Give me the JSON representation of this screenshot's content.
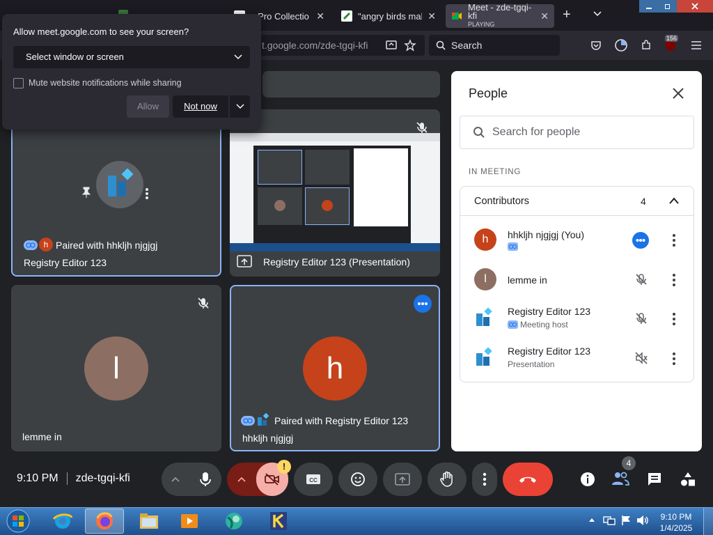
{
  "browser": {
    "tabs": [
      {
        "label": "s Pro Collectio",
        "close": "✕"
      },
      {
        "label": "\"angry birds maker",
        "close": "✕"
      },
      {
        "label": "Meet - zde-tgqi-kfi",
        "sub": "PLAYING",
        "close": "✕"
      }
    ],
    "new_tab": "+",
    "url": "t.google.com/zde-tgqi-kfi",
    "search_placeholder": "Search",
    "badge_count": "156"
  },
  "share_popup": {
    "title": "Allow meet.google.com to see your screen?",
    "select_value": "Select window or screen",
    "checkbox_label": "Mute website notifications while sharing",
    "allow": "Allow",
    "not_now": "Not now"
  },
  "tiles": {
    "t1": {
      "line1": "Paired with hhkljh njgjgj",
      "line2": "Registry Editor 123",
      "chip_letter": "h"
    },
    "t2": {
      "name": "Registry Editor 123 (Presentation)"
    },
    "t3": {
      "name": "lemme in",
      "avatar": "l"
    },
    "t4": {
      "line1": "Paired with Registry Editor 123",
      "line2": "hhkljh njgjgj",
      "avatar": "h"
    }
  },
  "people": {
    "title": "People",
    "search_placeholder": "Search for people",
    "section": "IN MEETING",
    "group": "Contributors",
    "count": "4",
    "rows": [
      {
        "name": "hhkljh njgjgj (You)",
        "avatar": "h",
        "sub": ""
      },
      {
        "name": "lemme in",
        "avatar": "l",
        "sub": ""
      },
      {
        "name": "Registry Editor 123",
        "sub": "Meeting host"
      },
      {
        "name": "Registry Editor 123",
        "sub": "Presentation"
      }
    ]
  },
  "meeting": {
    "time": "9:10 PM",
    "code": "zde-tgqi-kfi",
    "people_badge": "4"
  },
  "taskbar": {
    "time": "9:10 PM",
    "date": "1/4/2025"
  },
  "colors": {
    "accent_blue": "#1a73e8",
    "end_call_red": "#ea4335",
    "avatar_brown": "#8d6e63",
    "avatar_red": "#c5421b"
  }
}
